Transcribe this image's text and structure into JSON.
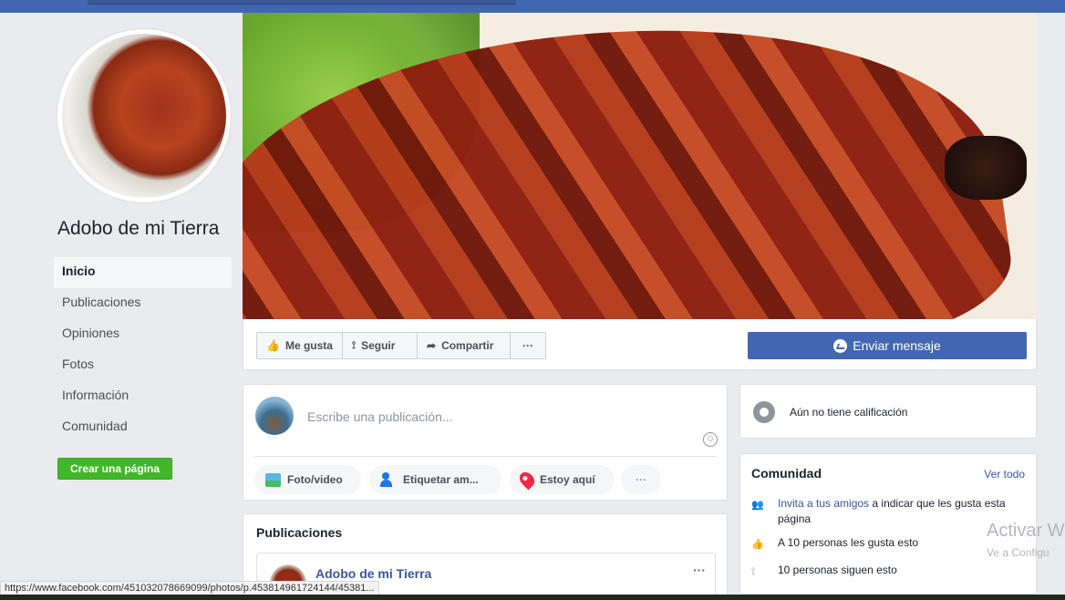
{
  "page": {
    "name": "Adobo de mi Tierra"
  },
  "nav": {
    "items": [
      {
        "label": "Inicio",
        "active": true
      },
      {
        "label": "Publicaciones"
      },
      {
        "label": "Opiniones"
      },
      {
        "label": "Fotos"
      },
      {
        "label": "Información"
      },
      {
        "label": "Comunidad"
      }
    ],
    "create_page": "Crear una página"
  },
  "actions": {
    "like": "Me gusta",
    "follow": "Seguir",
    "share": "Compartir",
    "more": "···",
    "message": "Enviar mensaje"
  },
  "composer": {
    "placeholder": "Escribe una publicación...",
    "photo": "Foto/video",
    "tag": "Etiquetar am...",
    "checkin": "Estoy aquí",
    "more": "···"
  },
  "posts": {
    "title": "Publicaciones",
    "first_author": "Adobo de mi Tierra",
    "more": "···"
  },
  "rating": {
    "text": "Aún no tiene calificación"
  },
  "community": {
    "title": "Comunidad",
    "see_all": "Ver todo",
    "invite_link": "Invita a tus amigos",
    "invite_rest": " a indicar que les gusta esta página",
    "likes": "A 10 personas les gusta esto",
    "follows": "10 personas siguen esto"
  },
  "watermark": {
    "title": "Activar W",
    "subtitle": "Ve a Configu"
  },
  "status_url": "https://www.facebook.com/451032078669099/photos/p.453814961724144/45381..."
}
